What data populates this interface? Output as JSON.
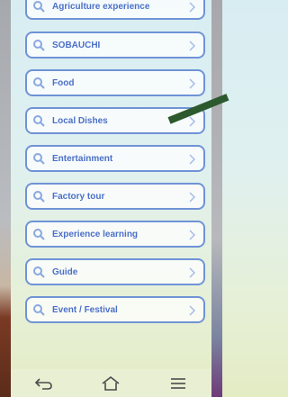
{
  "menu": {
    "items": [
      {
        "label": "Agriculture experience",
        "icon": "search-icon"
      },
      {
        "label": "SOBAUCHI",
        "icon": "search-icon"
      },
      {
        "label": "Food",
        "icon": "search-icon"
      },
      {
        "label": "Local Dishes",
        "icon": "search-icon"
      },
      {
        "label": "Entertainment",
        "icon": "search-icon"
      },
      {
        "label": "Factory tour",
        "icon": "search-icon"
      },
      {
        "label": "Experience learning",
        "icon": "search-icon"
      },
      {
        "label": "Guide",
        "icon": "search-icon"
      },
      {
        "label": "Event / Festival",
        "icon": "search-icon"
      }
    ]
  },
  "navbar": {
    "icons": [
      "back-icon",
      "home-icon",
      "menu-icon"
    ]
  },
  "colors": {
    "accent": "#6f93d6",
    "label": "#4b70c8",
    "pointer": "#2c5a2e"
  }
}
